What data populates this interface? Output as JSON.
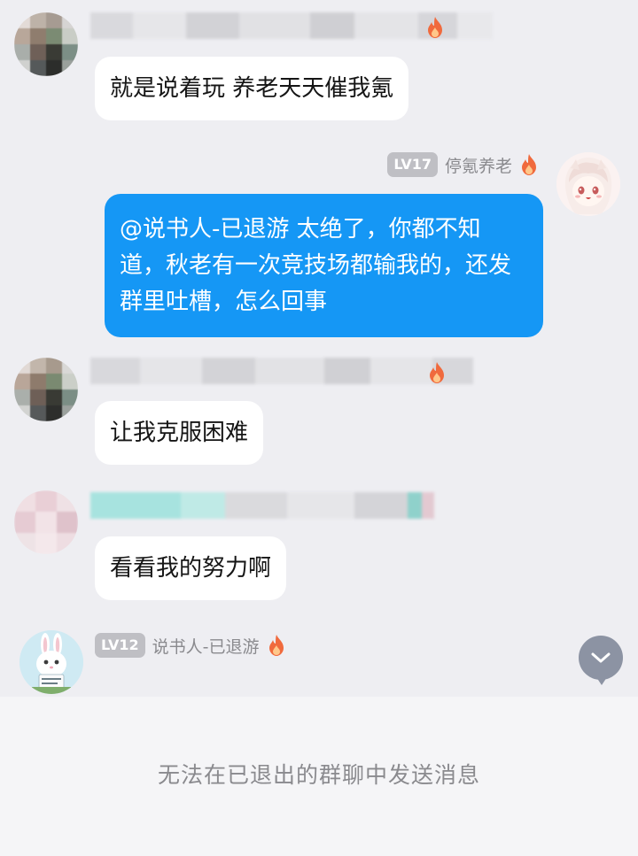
{
  "messages": [
    {
      "id": "m1",
      "side": "left",
      "text": "就是说着玩  养老天天催我氪"
    },
    {
      "id": "m2",
      "side": "right",
      "sender": {
        "level": "LV17",
        "name": "停氪养老"
      },
      "text": "@说书人-已退游 太绝了，你都不知道，秋老有一次竞技场都输我的，还发群里吐槽，怎么回事"
    },
    {
      "id": "m3",
      "side": "left",
      "text": "让我克服困难"
    },
    {
      "id": "m4",
      "side": "left",
      "text": "看看我的努力啊"
    },
    {
      "id": "m5",
      "side": "left",
      "sender": {
        "level": "LV12",
        "name": "说书人-已退游"
      }
    }
  ],
  "footer": {
    "notice": "无法在已退出的群聊中发送消息"
  },
  "icons": {
    "flame": "flame-icon",
    "scroll_down": "chevron-down-icon"
  },
  "colors": {
    "self_bubble": "#1597f5",
    "other_bubble": "#ffffff",
    "background": "#eeeef2",
    "badge": "#bfbfc4",
    "flame": "#f06a3d"
  }
}
